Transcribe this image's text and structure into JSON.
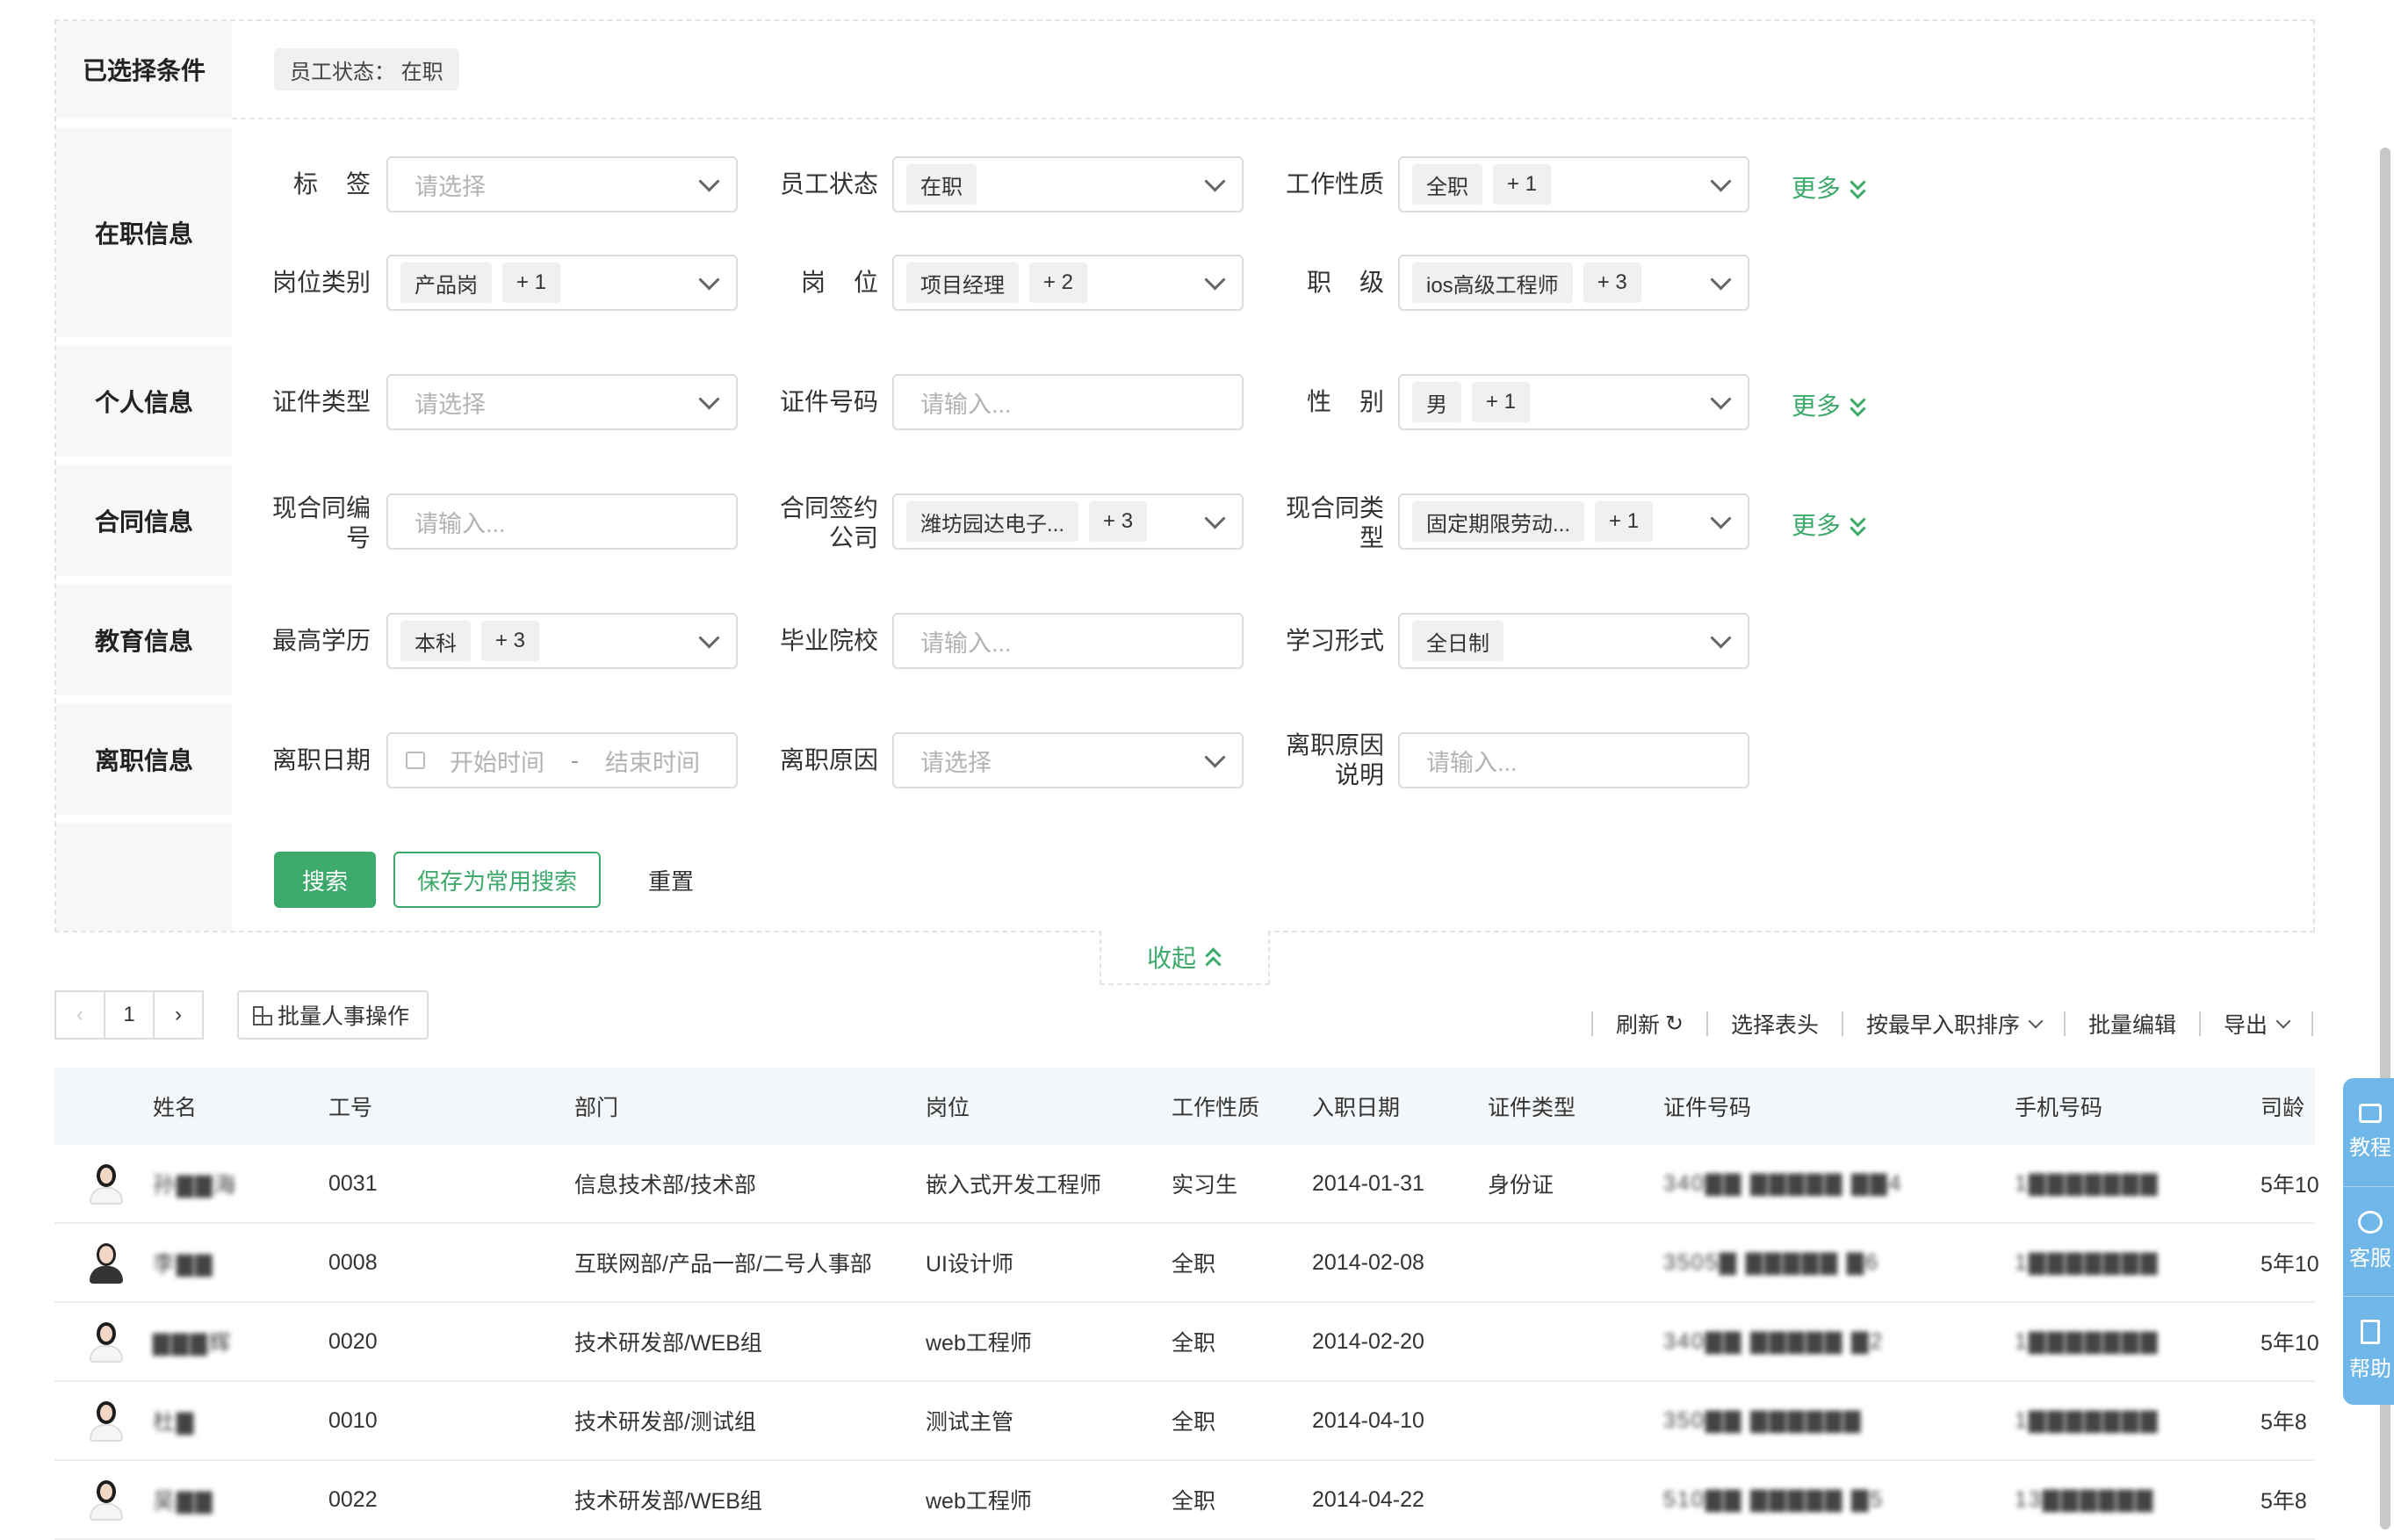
{
  "selected": {
    "label": "已选择条件",
    "chip": "员工状态： 在职"
  },
  "sections": {
    "job": "在职信息",
    "personal": "个人信息",
    "contract": "合同信息",
    "education": "教育信息",
    "leave": "离职信息"
  },
  "fields": {
    "tag": {
      "label": "标签",
      "placeholder": "请选择"
    },
    "status": {
      "label": "员工状态",
      "value": "在职"
    },
    "nature": {
      "label": "工作性质",
      "value": "全职",
      "extra": "+ 1"
    },
    "post_type": {
      "label": "岗位类别",
      "value": "产品岗",
      "extra": "+ 1"
    },
    "post": {
      "label": "岗位",
      "value": "项目经理",
      "extra": "+ 2"
    },
    "rank": {
      "label": "职级",
      "value": "ios高级工程师",
      "extra": "+ 3"
    },
    "id_type": {
      "label": "证件类型",
      "placeholder": "请选择"
    },
    "id_no": {
      "label": "证件号码",
      "placeholder": "请输入..."
    },
    "gender": {
      "label": "性别",
      "value": "男",
      "extra": "+ 1"
    },
    "contract_no": {
      "label_1": "现合同编",
      "label_2": "号",
      "placeholder": "请输入..."
    },
    "contract_company": {
      "label_1": "合同签约",
      "label_2": "公司",
      "value": "潍坊园达电子...",
      "extra": "+ 3"
    },
    "contract_type": {
      "label_1": "现合同类",
      "label_2": "型",
      "value": "固定期限劳动...",
      "extra": "+ 1"
    },
    "degree": {
      "label": "最高学历",
      "value": "本科",
      "extra": "+ 3"
    },
    "school": {
      "label": "毕业院校",
      "placeholder": "请输入..."
    },
    "study_form": {
      "label": "学习形式",
      "value": "全日制"
    },
    "leave_date": {
      "label": "离职日期",
      "start": "开始时间",
      "dash": "-",
      "end": "结束时间"
    },
    "leave_reason": {
      "label": "离职原因",
      "placeholder": "请选择"
    },
    "leave_note": {
      "label_1": "离职原因",
      "label_2": "说明",
      "placeholder": "请输入..."
    }
  },
  "more_label": "更多",
  "buttons": {
    "search": "搜索",
    "save": "保存为常用搜索",
    "reset": "重置",
    "collapse": "收起"
  },
  "pager": {
    "prev": "‹",
    "page": "1",
    "next": "›"
  },
  "bulk": "批量人事操作",
  "toolbar": {
    "refresh": "刷新",
    "refresh_icon": "↻",
    "columns": "选择表头",
    "sort": "按最早入职排序",
    "batch_edit": "批量编辑",
    "export": "导出"
  },
  "table": {
    "headers": {
      "name": "姓名",
      "no": "工号",
      "dept": "部门",
      "post": "岗位",
      "nature": "工作性质",
      "date": "入职日期",
      "id_type": "证件类型",
      "id_no": "证件号码",
      "phone": "手机号码",
      "tenure": "司龄"
    },
    "rows": [
      {
        "name": "孙▇▇海",
        "no": "0031",
        "dept": "信息技术部/技术部",
        "post": "嵌入式开发工程师",
        "nature": "实习生",
        "date": "2014-01-31",
        "id_type": "身份证",
        "id_no": "340▇▇ ▇▇▇▇▇ ▇▇4",
        "phone": "1▇▇▇▇▇▇▇",
        "tenure": "5年10"
      },
      {
        "name": "李▇▇",
        "no": "0008",
        "dept": "互联网部/产品一部/二号人事部",
        "post": "UI设计师",
        "nature": "全职",
        "date": "2014-02-08",
        "id_type": "",
        "id_no": "3505▇ ▇▇▇▇▇ ▇6",
        "phone": "1▇▇▇▇▇▇▇",
        "tenure": "5年10"
      },
      {
        "name": "▇▇▇辉",
        "no": "0020",
        "dept": "技术研发部/WEB组",
        "post": "web工程师",
        "nature": "全职",
        "date": "2014-02-20",
        "id_type": "",
        "id_no": "340▇▇ ▇▇▇▇▇ ▇2",
        "phone": "1▇▇▇▇▇▇▇",
        "tenure": "5年10"
      },
      {
        "name": "杜▇",
        "no": "0010",
        "dept": "技术研发部/测试组",
        "post": "测试主管",
        "nature": "全职",
        "date": "2014-04-10",
        "id_type": "",
        "id_no": "350▇▇ ▇▇▇▇▇▇",
        "phone": "1▇▇▇▇▇▇▇",
        "tenure": "5年8"
      },
      {
        "name": "吴▇▇",
        "no": "0022",
        "dept": "技术研发部/WEB组",
        "post": "web工程师",
        "nature": "全职",
        "date": "2014-04-22",
        "id_type": "",
        "id_no": "510▇▇ ▇▇▇▇▇ ▇5",
        "phone": "13▇▇▇▇▇▇",
        "tenure": "5年8"
      }
    ]
  },
  "side": {
    "tutorial": "教程",
    "service": "客服",
    "help": "帮助"
  }
}
